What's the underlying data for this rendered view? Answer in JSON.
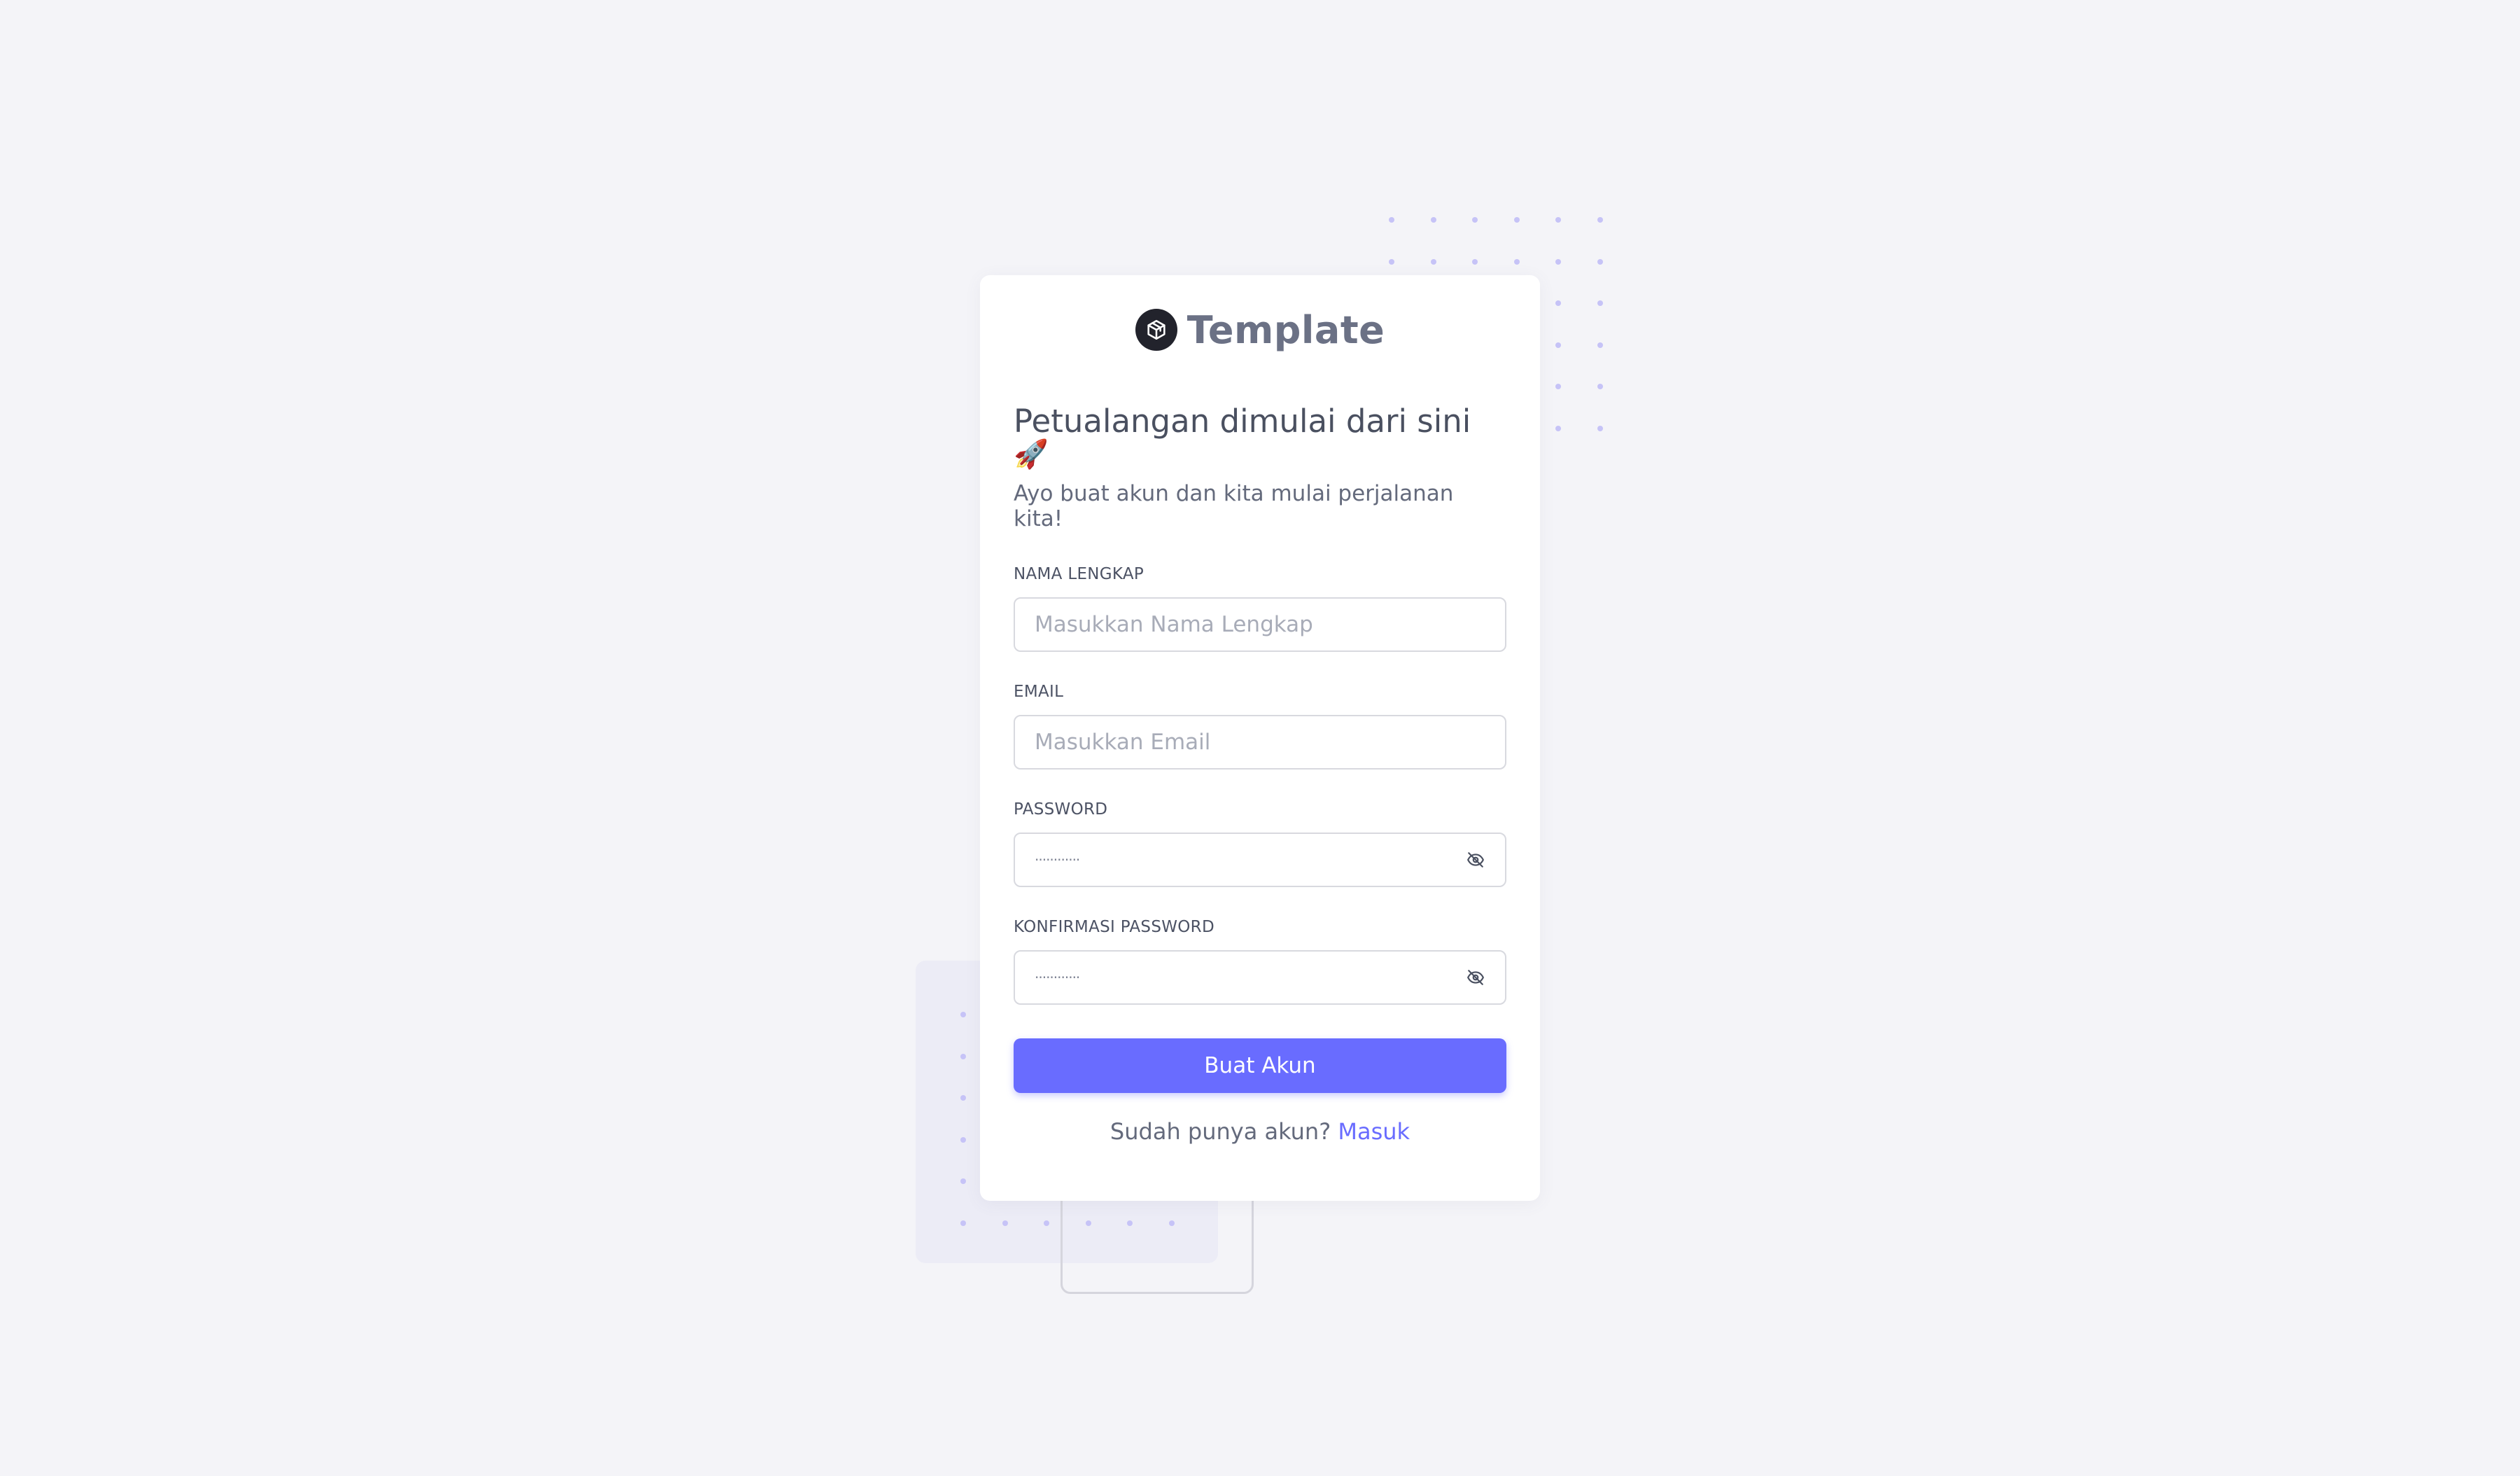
{
  "brand": {
    "name": "Template",
    "logo_icon": "box-icon"
  },
  "welcome": {
    "title": "Petualangan dimulai dari sini",
    "emoji": "🚀",
    "subtitle": "Ayo buat akun dan kita mulai perjalanan kita!"
  },
  "form": {
    "full_name": {
      "label": "NAMA LENGKAP",
      "placeholder": "Masukkan Nama Lengkap",
      "value": ""
    },
    "email": {
      "label": "EMAIL",
      "placeholder": "Masukkan Email",
      "value": ""
    },
    "password": {
      "label": "PASSWORD",
      "masked_value": "············",
      "toggle_icon": "eye-off-icon"
    },
    "confirm_password": {
      "label": "KONFIRMASI PASSWORD",
      "masked_value": "············",
      "toggle_icon": "eye-off-icon"
    },
    "submit_label": "Buat Akun"
  },
  "login_prompt": {
    "text": "Sudah punya akun?",
    "link_label": "Masuk"
  },
  "colors": {
    "primary": "#696cff",
    "page_background": "#f4f4f8",
    "card_background": "#ffffff",
    "heading_text": "#4a5060",
    "decor_dots": "#c6c3f7"
  }
}
